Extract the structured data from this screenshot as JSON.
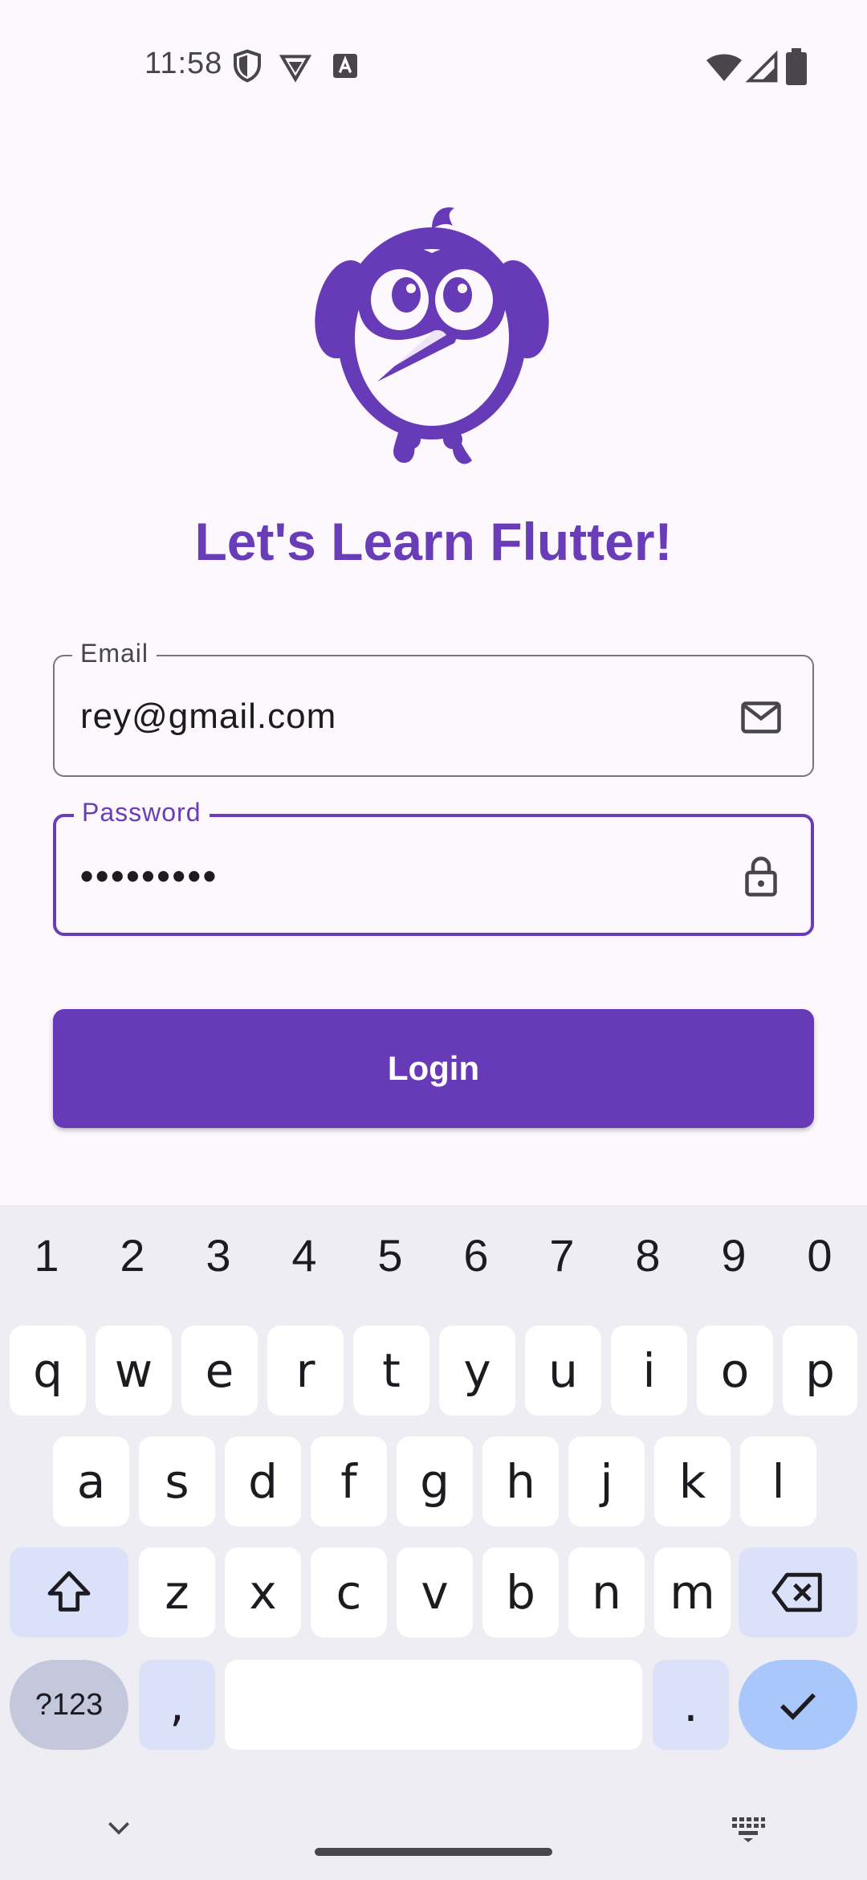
{
  "status_bar": {
    "time": "11:58",
    "icons": [
      "shield-icon",
      "vpn-icon",
      "keyboard-a-icon",
      "wifi-icon",
      "signal-icon",
      "battery-icon"
    ]
  },
  "app": {
    "logo": "flutter-bird-mascot",
    "title": "Let's Learn Flutter!",
    "accent_color": "#673ab7"
  },
  "email_field": {
    "label": "Email",
    "value": "rey@gmail.com",
    "icon": "mail-icon"
  },
  "password_field": {
    "label": "Password",
    "value": "•••••••••",
    "icon": "lock-icon",
    "focused": true
  },
  "login_button": {
    "label": "Login"
  },
  "keyboard": {
    "number_row": [
      "1",
      "2",
      "3",
      "4",
      "5",
      "6",
      "7",
      "8",
      "9",
      "0"
    ],
    "row1": [
      "q",
      "w",
      "e",
      "r",
      "t",
      "y",
      "u",
      "i",
      "o",
      "p"
    ],
    "row2": [
      "a",
      "s",
      "d",
      "f",
      "g",
      "h",
      "j",
      "k",
      "l"
    ],
    "row3": [
      "z",
      "x",
      "c",
      "v",
      "b",
      "n",
      "m"
    ],
    "symbols_label": "?123",
    "comma_label": ",",
    "period_label": ".",
    "shift_icon": "shift-icon",
    "backspace_icon": "backspace-icon",
    "enter_icon": "check-icon"
  },
  "nav_bar": {
    "hide_keyboard_icon": "chevron-down-icon",
    "switch_keyboard_icon": "keyboard-icon"
  }
}
